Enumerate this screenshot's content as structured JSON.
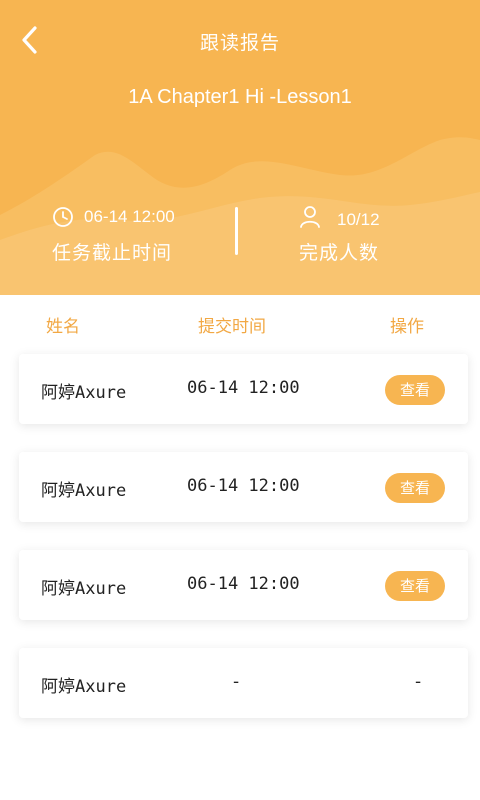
{
  "header": {
    "title": "跟读报告",
    "lesson": "1A Chapter1 Hi -Lesson1",
    "back_icon": "chevron-left-icon",
    "deadline": {
      "icon": "clock-icon",
      "value": "06-14 12:00",
      "label": "任务截止时间"
    },
    "completed": {
      "icon": "person-icon",
      "value": "10/12",
      "label": "完成人数"
    }
  },
  "table": {
    "columns": [
      "姓名",
      "提交时间",
      "操作"
    ],
    "rows": [
      {
        "name": "阿婷Axure",
        "time": "06-14 12:00",
        "action": "查看"
      },
      {
        "name": "阿婷Axure",
        "time": "06-14 12:00",
        "action": "查看"
      },
      {
        "name": "阿婷Axure",
        "time": "06-14 12:00",
        "action": "查看"
      },
      {
        "name": "阿婷Axure",
        "time": "-",
        "action": "-"
      }
    ]
  },
  "colors": {
    "primary": "#f7b551",
    "header_text": "#ffffff",
    "column_header": "#f2a844"
  }
}
